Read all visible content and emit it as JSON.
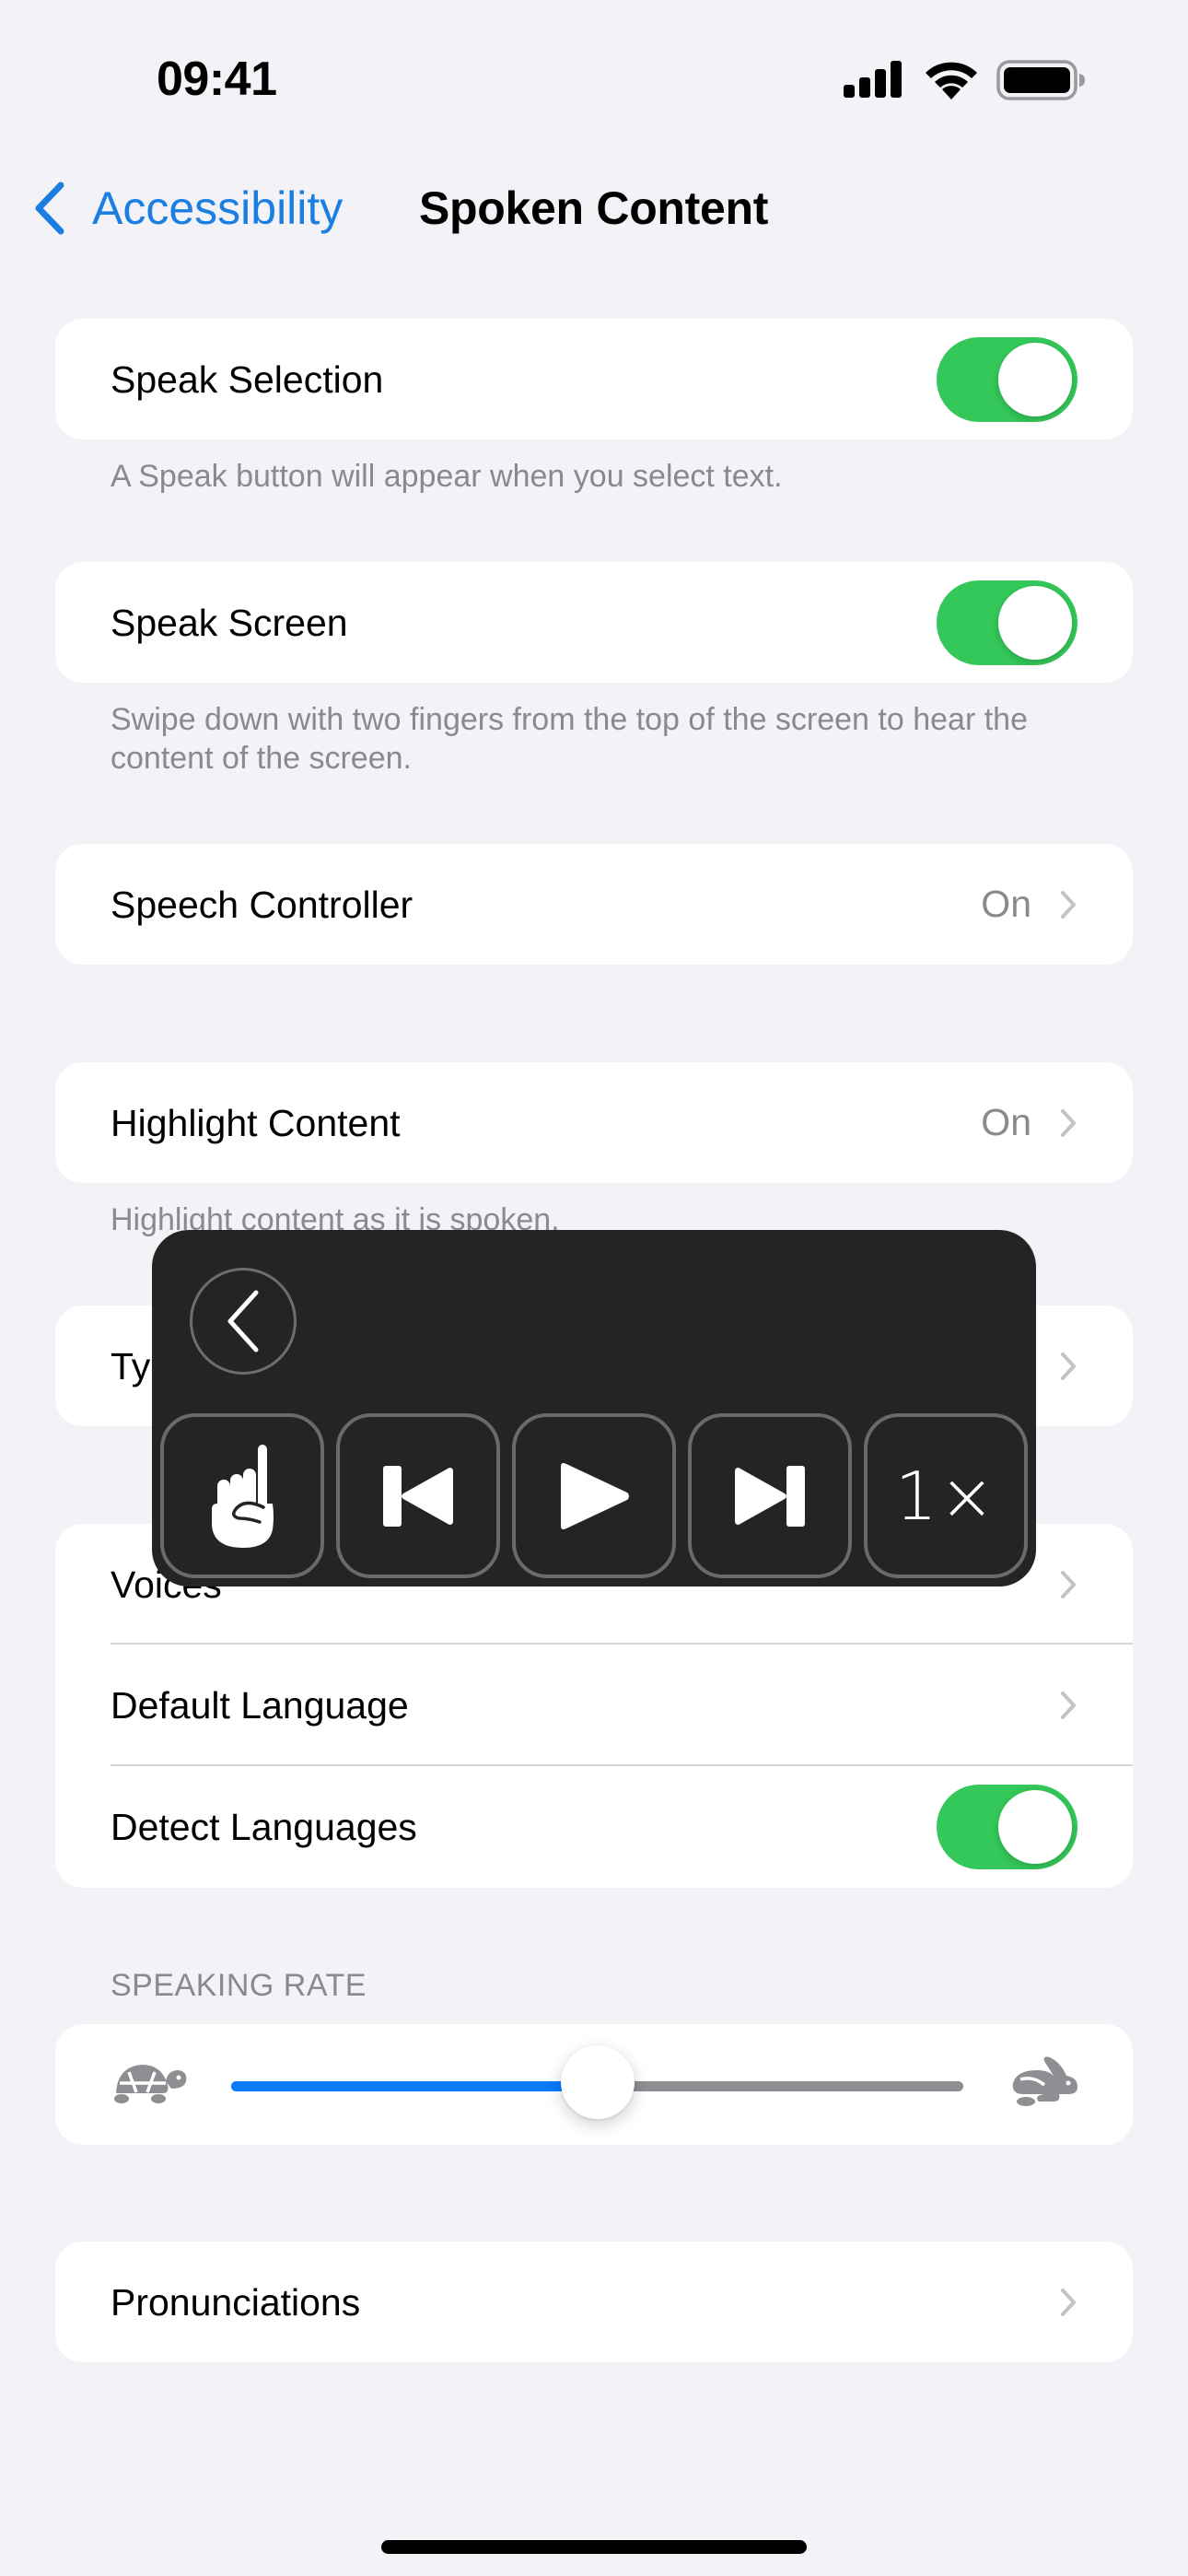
{
  "status_bar": {
    "time": "09:41",
    "icons": [
      "cellular-signal-icon",
      "wifi-icon",
      "battery-icon"
    ]
  },
  "nav": {
    "back_label": "Accessibility",
    "title": "Spoken Content"
  },
  "colors": {
    "accent": "#1A7FE0",
    "toggle_on": "#34C759",
    "background": "#F2F2F7",
    "secondary_text": "#8A8A8E",
    "overlay_bg": "#242424",
    "slider_fill": "#0A7AFF"
  },
  "sections": {
    "speak_selection": {
      "label": "Speak Selection",
      "enabled": true,
      "footer": "A Speak button will appear when you select text."
    },
    "speak_screen": {
      "label": "Speak Screen",
      "enabled": true,
      "footer": "Swipe down with two fingers from the top of the screen to hear the content of the screen."
    },
    "speech_controller": {
      "label": "Speech Controller",
      "value": "On"
    },
    "highlight_content": {
      "label": "Highlight Content",
      "value": "On",
      "footer": "Highlight content as it is spoken."
    },
    "typing": {
      "label": "Ty"
    },
    "voice_group": {
      "voices": {
        "label": "Voices"
      },
      "default_language": {
        "label": "Default Language"
      },
      "detect_languages": {
        "label": "Detect Languages",
        "enabled": true
      }
    },
    "speaking_rate": {
      "header": "SPEAKING RATE",
      "value_fraction": 0.5,
      "min_icon": "tortoise-icon",
      "max_icon": "hare-icon"
    },
    "pronunciations": {
      "label": "Pronunciations"
    }
  },
  "speech_controller_overlay": {
    "back_icon": "chevron-left-icon",
    "buttons": [
      {
        "name": "read-under-finger",
        "icon": "hand-point-up-icon"
      },
      {
        "name": "skip-back",
        "icon": "backward-end-icon"
      },
      {
        "name": "play",
        "icon": "play-icon"
      },
      {
        "name": "skip-forward",
        "icon": "forward-end-icon"
      },
      {
        "name": "speaking-rate",
        "label": "1×"
      }
    ]
  }
}
